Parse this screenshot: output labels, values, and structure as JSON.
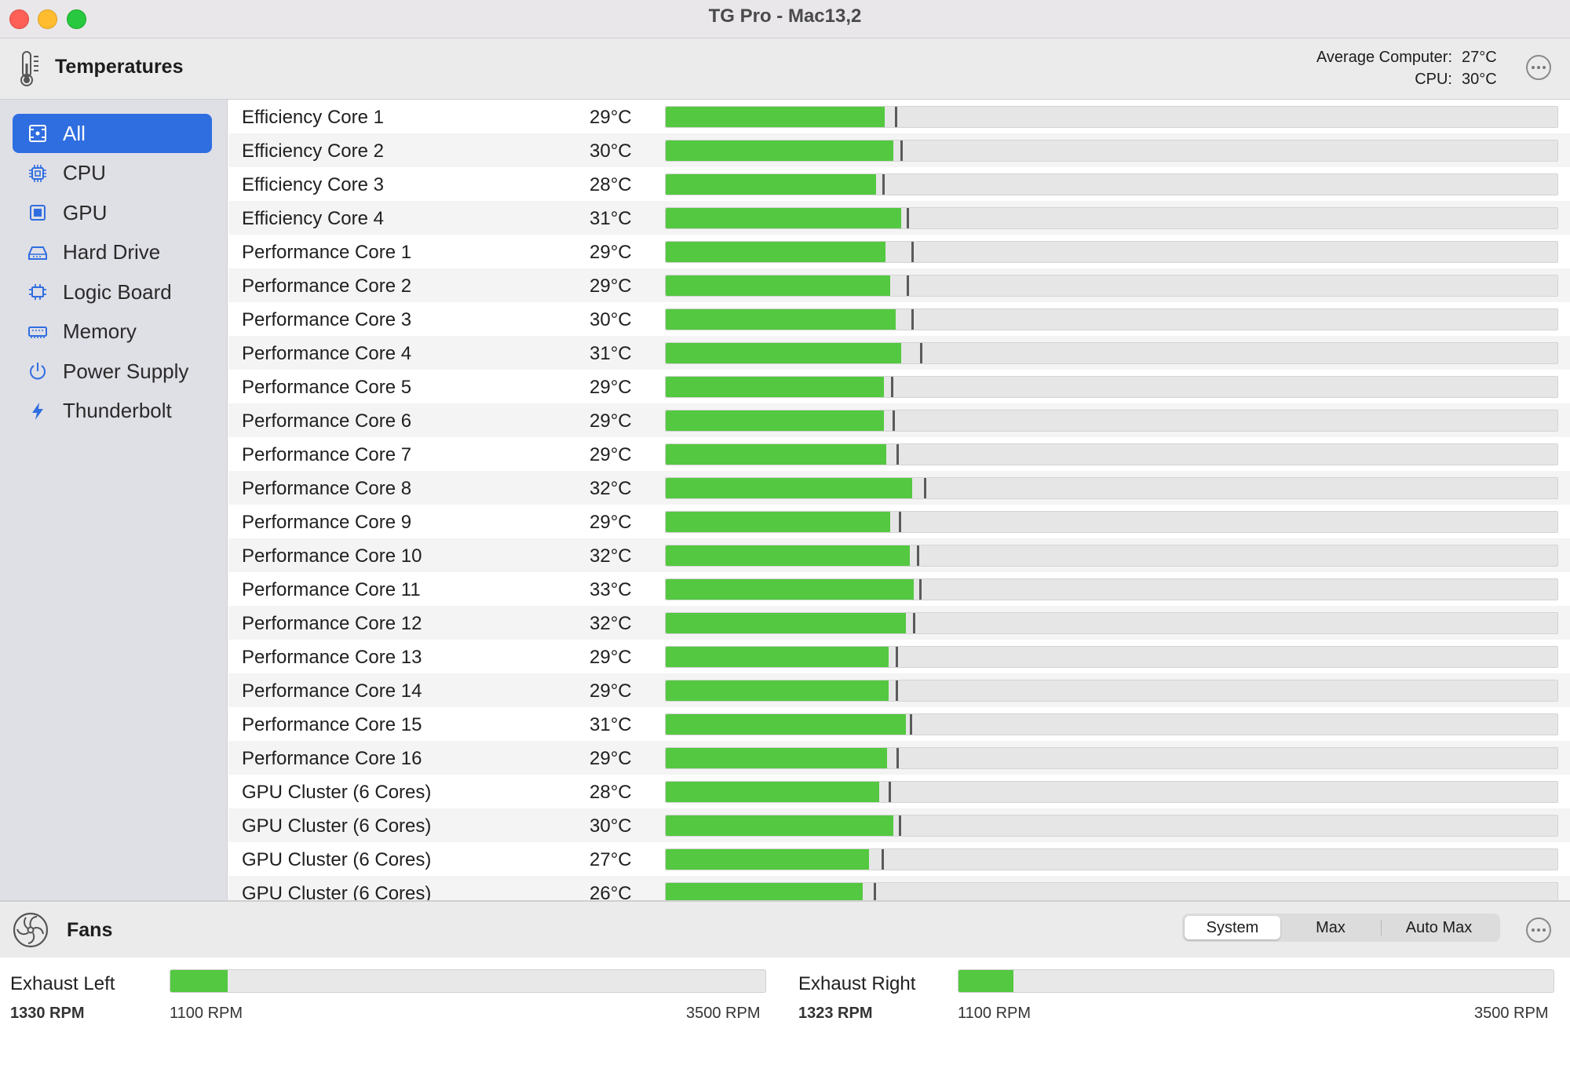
{
  "window": {
    "title": "TG Pro - Mac13,2"
  },
  "temperatures": {
    "title": "Temperatures",
    "average_computer_label": "Average Computer:",
    "average_computer_value": "27°C",
    "cpu_label": "CPU:",
    "cpu_value": "30°C"
  },
  "sidebar": {
    "items": [
      {
        "label": "All",
        "icon": "all-sensors-icon",
        "active": true
      },
      {
        "label": "CPU",
        "icon": "cpu-chip-icon",
        "active": false
      },
      {
        "label": "GPU",
        "icon": "gpu-chip-icon",
        "active": false
      },
      {
        "label": "Hard Drive",
        "icon": "hard-drive-icon",
        "active": false
      },
      {
        "label": "Logic Board",
        "icon": "logic-board-icon",
        "active": false
      },
      {
        "label": "Memory",
        "icon": "memory-icon",
        "active": false
      },
      {
        "label": "Power Supply",
        "icon": "power-icon",
        "active": false
      },
      {
        "label": "Thunderbolt",
        "icon": "thunderbolt-icon",
        "active": false
      }
    ]
  },
  "scale": {
    "min_c": 0,
    "max_c": 120,
    "marker_offset_c": 0.9
  },
  "sensors": [
    {
      "name": "Efficiency Core 1",
      "value": "29°C",
      "temp": 29.5,
      "peak": 30.8
    },
    {
      "name": "Efficiency Core 2",
      "value": "30°C",
      "temp": 30.6,
      "peak": 31.6
    },
    {
      "name": "Efficiency Core 3",
      "value": "28°C",
      "temp": 28.3,
      "peak": 29.2
    },
    {
      "name": "Efficiency Core 4",
      "value": "31°C",
      "temp": 31.7,
      "peak": 32.4
    },
    {
      "name": "Performance Core 1",
      "value": "29°C",
      "temp": 29.6,
      "peak": 33.1
    },
    {
      "name": "Performance Core 2",
      "value": "29°C",
      "temp": 30.2,
      "peak": 32.4
    },
    {
      "name": "Performance Core 3",
      "value": "30°C",
      "temp": 31.0,
      "peak": 33.1
    },
    {
      "name": "Performance Core 4",
      "value": "31°C",
      "temp": 31.7,
      "peak": 34.2
    },
    {
      "name": "Performance Core 5",
      "value": "29°C",
      "temp": 29.4,
      "peak": 30.3
    },
    {
      "name": "Performance Core 6",
      "value": "29°C",
      "temp": 29.4,
      "peak": 30.5
    },
    {
      "name": "Performance Core 7",
      "value": "29°C",
      "temp": 29.7,
      "peak": 31.1
    },
    {
      "name": "Performance Core 8",
      "value": "32°C",
      "temp": 33.2,
      "peak": 34.8
    },
    {
      "name": "Performance Core 9",
      "value": "29°C",
      "temp": 30.2,
      "peak": 31.4
    },
    {
      "name": "Performance Core 10",
      "value": "32°C",
      "temp": 32.8,
      "peak": 33.8
    },
    {
      "name": "Performance Core 11",
      "value": "33°C",
      "temp": 33.4,
      "peak": 34.1
    },
    {
      "name": "Performance Core 12",
      "value": "32°C",
      "temp": 32.3,
      "peak": 33.3
    },
    {
      "name": "Performance Core 13",
      "value": "29°C",
      "temp": 30.0,
      "peak": 31.0
    },
    {
      "name": "Performance Core 14",
      "value": "29°C",
      "temp": 30.0,
      "peak": 31.0
    },
    {
      "name": "Performance Core 15",
      "value": "31°C",
      "temp": 32.3,
      "peak": 32.8
    },
    {
      "name": "Performance Core 16",
      "value": "29°C",
      "temp": 29.8,
      "peak": 31.1
    },
    {
      "name": "GPU Cluster (6 Cores)",
      "value": "28°C",
      "temp": 28.7,
      "peak": 30.0
    },
    {
      "name": "GPU Cluster (6 Cores)",
      "value": "30°C",
      "temp": 30.6,
      "peak": 31.4
    },
    {
      "name": "GPU Cluster (6 Cores)",
      "value": "27°C",
      "temp": 27.4,
      "peak": 29.0
    },
    {
      "name": "GPU Cluster (6 Cores)",
      "value": "26°C",
      "temp": 26.5,
      "peak": 28.0
    }
  ],
  "fans": {
    "title": "Fans",
    "modes": [
      "System",
      "Max",
      "Auto Max"
    ],
    "selected_mode": "System",
    "items": [
      {
        "name": "Exhaust Left",
        "rpm": "1330 RPM",
        "min": "1100 RPM",
        "max": "3500 RPM",
        "fill_fraction": 0.096
      },
      {
        "name": "Exhaust Right",
        "rpm": "1323 RPM",
        "min": "1100 RPM",
        "max": "3500 RPM",
        "fill_fraction": 0.093
      }
    ]
  },
  "colors": {
    "accent": "#2f6ee0",
    "bar_green": "#53c840",
    "sidebar_icon": "#2f6ee0"
  }
}
